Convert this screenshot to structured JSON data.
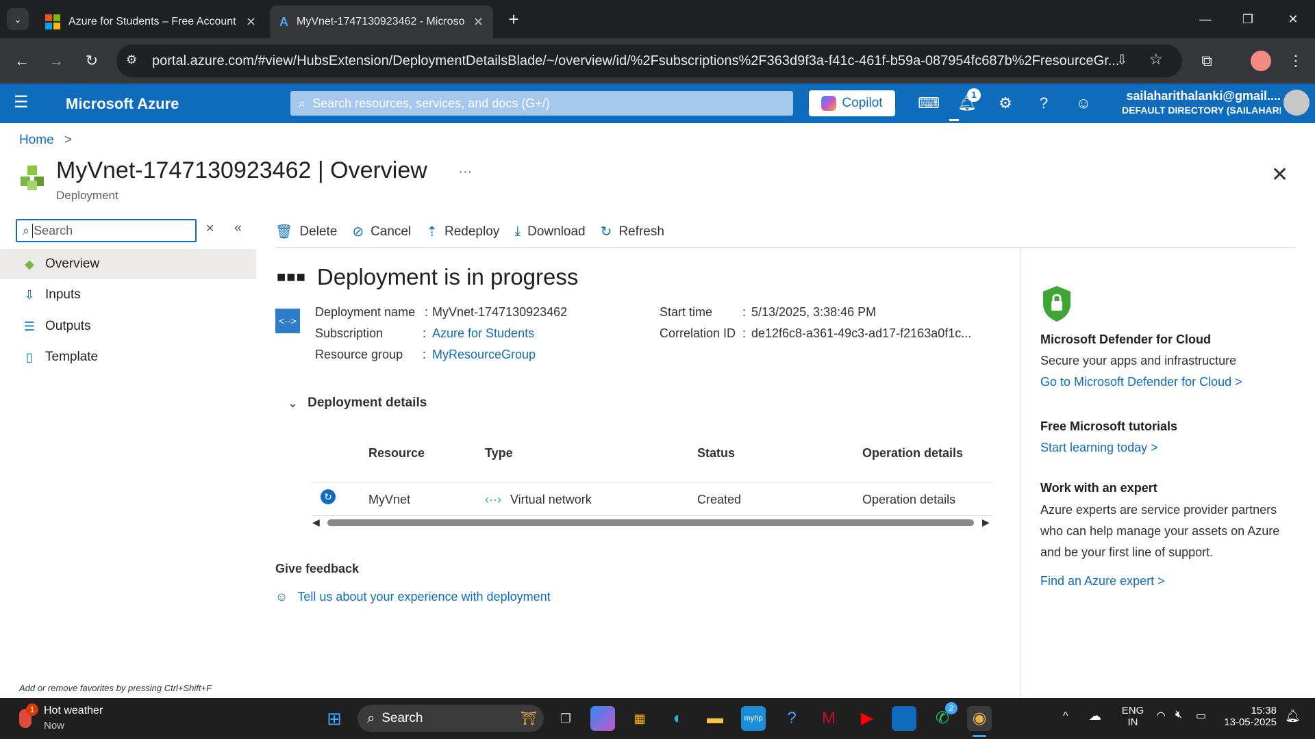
{
  "browser": {
    "tabs": [
      {
        "title": "Azure for Students – Free Account"
      },
      {
        "title": "MyVnet-1747130923462 - Microso"
      }
    ],
    "new_tab": "+",
    "url": "portal.azure.com/#view/HubsExtension/DeploymentDetailsBlade/~/overview/id/%2Fsubscriptions%2F363d9f3a-f41c-461f-b59a-087954fc687b%2FresourceGr..."
  },
  "azure": {
    "brand": "Microsoft Azure",
    "search_placeholder": "Search resources, services, and docs (G+/)",
    "copilot_label": "Copilot",
    "notification_count": "1",
    "account_email": "sailaharithalanki@gmail....",
    "account_directory": "DEFAULT DIRECTORY (SAILAHARI..."
  },
  "breadcrumb": {
    "home": "Home",
    "sep": ">"
  },
  "header": {
    "title": "MyVnet-1747130923462 | Overview",
    "subtitle": "Deployment",
    "more": "···"
  },
  "nav": {
    "search_placeholder": "Search",
    "items": [
      {
        "label": "Overview"
      },
      {
        "label": "Inputs"
      },
      {
        "label": "Outputs"
      },
      {
        "label": "Template"
      }
    ],
    "favorites_hint": "Add or remove favorites by pressing Ctrl+Shift+F"
  },
  "toolbar": {
    "delete": "Delete",
    "cancel": "Cancel",
    "redeploy": "Redeploy",
    "download": "Download",
    "refresh": "Refresh"
  },
  "deployment": {
    "status": "Deployment is in progress",
    "name_label": "Deployment name",
    "name_value": "MyVnet-1747130923462",
    "subscription_label": "Subscription",
    "subscription_value": "Azure for Students",
    "rg_label": "Resource group",
    "rg_value": "MyResourceGroup",
    "start_label": "Start time",
    "start_value": "5/13/2025, 3:38:46 PM",
    "corr_label": "Correlation ID",
    "corr_value": "de12f6c8-a361-49c3-ad17-f2163a0f1c...",
    "colon": ":"
  },
  "details": {
    "toggle_label": "Deployment details",
    "columns": [
      "Resource",
      "Type",
      "Status",
      "Operation details"
    ],
    "rows": [
      {
        "resource": "MyVnet",
        "type": "Virtual network",
        "status": "Created",
        "operation": "Operation details"
      }
    ]
  },
  "feedback": {
    "title": "Give feedback",
    "link": "Tell us about your experience with deployment"
  },
  "right_panel": {
    "defender_title": "Microsoft Defender for Cloud",
    "defender_text": "Secure your apps and infrastructure",
    "defender_link": "Go to Microsoft Defender for Cloud >",
    "tutorials_title": "Free Microsoft tutorials",
    "tutorials_link": "Start learning today >",
    "expert_title": "Work with an expert",
    "expert_text_1": "Azure experts are service provider partners",
    "expert_text_2": "who can help manage your assets on Azure",
    "expert_text_3": "and be your first line of support.",
    "expert_link": "Find an Azure expert >"
  },
  "taskbar": {
    "weather_title": "Hot weather",
    "weather_sub": "Now",
    "weather_badge": "1",
    "search_label": "Search",
    "whatsapp_badge": "2",
    "lang_1": "ENG",
    "lang_2": "IN",
    "time": "15:38",
    "date": "13-05-2025"
  },
  "colors": {
    "azure_blue": "#0f6cbd",
    "chrome_dark": "#202124",
    "taskbar": "#1f1f1f",
    "defender_green": "#3fa535"
  }
}
